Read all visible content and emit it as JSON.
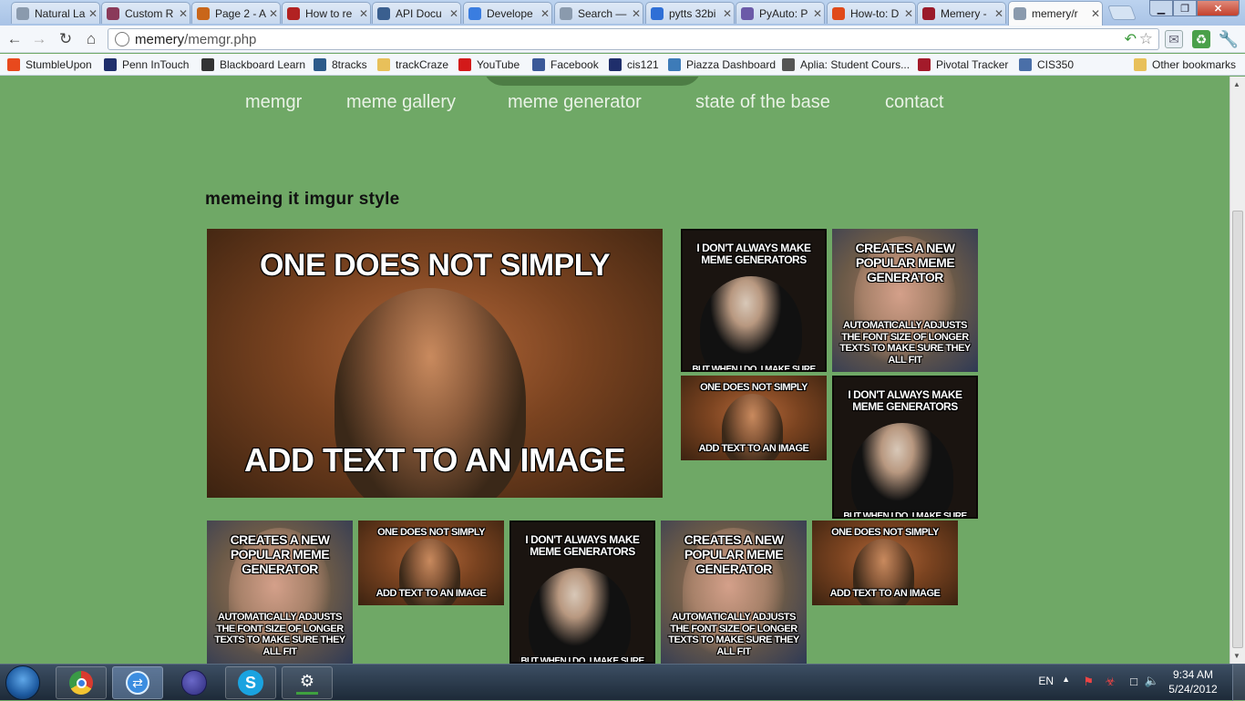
{
  "browser": {
    "tabs": [
      {
        "title": "Natural La",
        "icon": "globe-icon",
        "color": "#8a9aad"
      },
      {
        "title": "Custom R",
        "icon": "custom-r-favicon",
        "color": "#8a3a5a"
      },
      {
        "title": "Page 2 - A",
        "icon": "e-favicon",
        "color": "#c9661a"
      },
      {
        "title": "How to re",
        "icon": "q-favicon",
        "color": "#b22222"
      },
      {
        "title": "API Docu",
        "icon": "api-favicon",
        "color": "#3a5f8f"
      },
      {
        "title": "Develope",
        "icon": "google-favicon",
        "color": "#3a7de0"
      },
      {
        "title": "Search —",
        "icon": "globe-icon",
        "color": "#8a9aad"
      },
      {
        "title": "pytts 32bi",
        "icon": "google-g-favicon",
        "color": "#2f6fd6"
      },
      {
        "title": "PyAuto: P",
        "icon": "page-favicon",
        "color": "#6b5aa8"
      },
      {
        "title": "How-to: D",
        "icon": "ars-favicon",
        "color": "#e04a1a"
      },
      {
        "title": "Memery -",
        "icon": "memery-favicon",
        "color": "#9a1a2a"
      },
      {
        "title": "memery/r",
        "icon": "globe-icon",
        "color": "#8a9aad"
      }
    ],
    "url_host": "memery",
    "url_path": "/memgr.php",
    "bookmarks": [
      {
        "label": "StumbleUpon",
        "icon": "stumbleupon-icon",
        "color": "#e8491d"
      },
      {
        "label": "Penn InTouch",
        "icon": "penn-shield-icon",
        "color": "#1f2e6b"
      },
      {
        "label": "Blackboard Learn",
        "icon": "blackboard-icon",
        "color": "#333333"
      },
      {
        "label": "8tracks",
        "icon": "8tracks-icon",
        "color": "#2d5a8a"
      },
      {
        "label": "trackCraze",
        "icon": "folder-icon",
        "color": "#e8c05a"
      },
      {
        "label": "YouTube",
        "icon": "youtube-icon",
        "color": "#d31a1a"
      },
      {
        "label": "Facebook",
        "icon": "facebook-icon",
        "color": "#3b5998"
      },
      {
        "label": "cis121",
        "icon": "penn-shield-icon",
        "color": "#1f2e6b"
      },
      {
        "label": "Piazza Dashboard",
        "icon": "piazza-icon",
        "color": "#3d7bb8"
      },
      {
        "label": "Aplia: Student Cours...",
        "icon": "aplia-icon",
        "color": "#555555"
      },
      {
        "label": "Pivotal Tracker",
        "icon": "pivotal-icon",
        "color": "#a31a2a"
      },
      {
        "label": "CIS350",
        "icon": "cis350-icon",
        "color": "#4a6fa8"
      }
    ],
    "other_bookmarks": "Other bookmarks"
  },
  "nav": {
    "items": [
      "memgr",
      "meme gallery",
      "meme generator",
      "state of the base",
      "contact"
    ]
  },
  "page": {
    "title": "memeing it imgur style"
  },
  "memes": {
    "boromir": {
      "top": "ONE DOES NOT SIMPLY",
      "bottom": "ADD TEXT TO AN IMAGE"
    },
    "xx": {
      "top": "I DON'T ALWAYS MAKE MEME GENERATORS",
      "bottom": "BUT WHEN I DO, I MAKE SURE"
    },
    "gg": {
      "top": "CREATES A NEW POPULAR MEME GENERATOR",
      "bottom": "AUTOMATICALLY ADJUSTS THE FONT SIZE OF LONGER TEXTS TO MAKE SURE THEY ALL FIT"
    }
  },
  "taskbar": {
    "apps": [
      "chrome-icon",
      "teamviewer-icon",
      "eclipse-icon",
      "skype-icon",
      "git-icon"
    ],
    "lang": "EN",
    "time": "9:34 AM",
    "date": "5/24/2012"
  }
}
